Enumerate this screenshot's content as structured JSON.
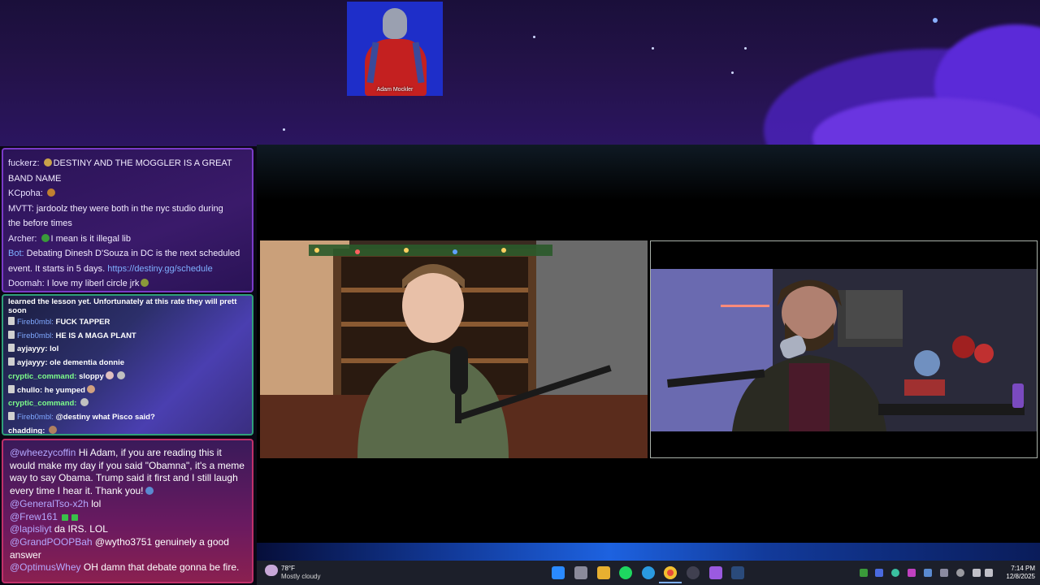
{
  "cam": {
    "name": "Adam Mockler"
  },
  "chat1": {
    "messages": [
      {
        "user": "fuckerz:",
        "text": "DESTINY AND THE MOGGLER IS A GREAT",
        "cont": "BAND NAME"
      },
      {
        "user": "KCpoha:",
        "text": ""
      },
      {
        "user": "MVTT:",
        "text": "jardoolz they were both in the nyc studio during",
        "cont": "the before times"
      },
      {
        "user": "Archer:",
        "text": "I mean is it illegal lib"
      },
      {
        "user": "Bot:",
        "text": "Debating Dinesh D'Souza in DC is the next scheduled",
        "cont": "event. It starts in 5 days.",
        "link": "https://destiny.gg/schedule"
      },
      {
        "user": "Doomah:",
        "text": "I love my liberl circle jrk"
      }
    ]
  },
  "chat2": {
    "top_partial": "learned the lesson yet. Unfortunately at this rate they will prett",
    "top_partial2": "soon",
    "messages": [
      {
        "user": "Fireb0mbl:",
        "text": "FUCK TAPPER",
        "kind": "fb"
      },
      {
        "user": "Fireb0mbl:",
        "text": "HE IS A MAGA PLANT",
        "kind": "fb"
      },
      {
        "user": "ayjayyy:",
        "text": "lol",
        "kind": "plain"
      },
      {
        "user": "ayjayyy:",
        "text": "ole dementia donnie",
        "kind": "plain"
      },
      {
        "user": "cryptic_command:",
        "text": "sloppy",
        "kind": "cy"
      },
      {
        "user": "chullo:",
        "text": "he yumped",
        "kind": "plain"
      },
      {
        "user": "cryptic_command:",
        "text": "",
        "kind": "cy"
      },
      {
        "user": "Fireb0mbl:",
        "text": "@destiny what Pisco said?",
        "kind": "fb"
      },
      {
        "user": "chadding:",
        "text": "",
        "kind": "plain"
      }
    ]
  },
  "chat3": {
    "messages": [
      {
        "user": "@wheezycoffin",
        "text": "Hi Adam, if you are reading this it would make my day if you said \"Obamna\", it's a meme way to say Obama. Trump said it first and I still laugh every time I hear it. Thank you!"
      },
      {
        "user": "@GeneralTso-x2h",
        "text": "lol"
      },
      {
        "user": "@Frew161",
        "text": ""
      },
      {
        "user": "@lapisliyt",
        "text": "da IRS. LOL"
      },
      {
        "user": "@GrandPOOPBah",
        "text": "@wytho3751 genuinely a good answer"
      },
      {
        "user": "@OptimusWhey",
        "text": "OH damn that debate gonna be fire."
      }
    ]
  },
  "taskbar": {
    "weather_temp": "78°F",
    "weather_desc": "Mostly cloudy",
    "time": "7:14 PM",
    "date": "12/8/2025",
    "icons": [
      "windows-start-icon",
      "task-view-icon",
      "file-explorer-icon",
      "spotify-icon",
      "edge-icon",
      "chrome-icon",
      "obs-icon",
      "app-purple-icon",
      "steam-icon"
    ]
  },
  "colors": {
    "accent_purple": "#7a3ac8",
    "accent_green": "#2fa07a",
    "accent_pink": "#c0306a"
  }
}
